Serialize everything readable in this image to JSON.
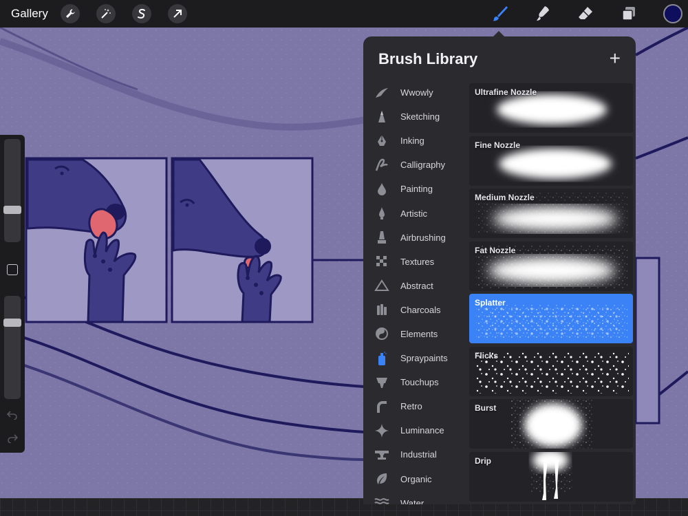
{
  "topbar": {
    "gallery_label": "Gallery",
    "left_tools": [
      "wrench-icon",
      "magic-wand-icon",
      "selection-icon",
      "transform-arrow-icon"
    ],
    "right_tools": [
      "brush-icon",
      "smudge-icon",
      "eraser-icon",
      "layers-icon"
    ],
    "current_color": "#0e0e5c",
    "active_tool_color": "#3a82f6"
  },
  "sidebar": {
    "size_slider_level": 0.62,
    "opacity_slider_level": 0.25
  },
  "brush_library": {
    "title": "Brush Library",
    "add_icon": "+",
    "categories": [
      {
        "label": "Wwowly",
        "icon": "swoosh-icon"
      },
      {
        "label": "Sketching",
        "icon": "pencil-tip-icon"
      },
      {
        "label": "Inking",
        "icon": "pen-nib-icon"
      },
      {
        "label": "Calligraphy",
        "icon": "calligraphy-icon"
      },
      {
        "label": "Painting",
        "icon": "paint-drop-icon"
      },
      {
        "label": "Artistic",
        "icon": "artistic-drop-icon"
      },
      {
        "label": "Airbrushing",
        "icon": "airbrush-icon"
      },
      {
        "label": "Textures",
        "icon": "checker-icon"
      },
      {
        "label": "Abstract",
        "icon": "triangle-icon"
      },
      {
        "label": "Charcoals",
        "icon": "charcoal-icon"
      },
      {
        "label": "Elements",
        "icon": "yin-yang-icon"
      },
      {
        "label": "Spraypaints",
        "icon": "spraycan-icon"
      },
      {
        "label": "Touchups",
        "icon": "touchup-icon"
      },
      {
        "label": "Retro",
        "icon": "retro-icon"
      },
      {
        "label": "Luminance",
        "icon": "sparkle-icon"
      },
      {
        "label": "Industrial",
        "icon": "anvil-icon"
      },
      {
        "label": "Organic",
        "icon": "leaf-icon"
      },
      {
        "label": "Water",
        "icon": "waves-icon"
      }
    ],
    "selected_category": "Spraypaints",
    "brushes": [
      {
        "name": "Ultrafine Nozzle"
      },
      {
        "name": "Fine Nozzle"
      },
      {
        "name": "Medium Nozzle"
      },
      {
        "name": "Fat Nozzle"
      },
      {
        "name": "Splatter"
      },
      {
        "name": "Flicks"
      },
      {
        "name": "Burst"
      },
      {
        "name": "Drip"
      }
    ],
    "selected_brush": "Splatter",
    "selected_brush_color": "#3a82f6"
  },
  "canvas": {
    "background_color": "#7d77a8",
    "line_color": "#1e1a5c",
    "tongue_color": "#e0676f"
  }
}
